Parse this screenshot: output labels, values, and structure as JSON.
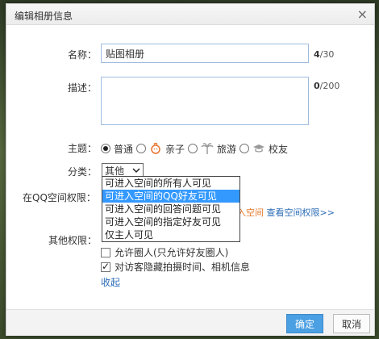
{
  "dialog": {
    "title": "编辑相册信息",
    "close_glyph": "×"
  },
  "form": {
    "name_label": "名称：",
    "name_value": "贴图相册",
    "name_count": "4",
    "name_max": "/30",
    "desc_label": "描述：",
    "desc_value": "",
    "desc_count": "0",
    "desc_max": "/200",
    "theme_label": "主题：",
    "themes": [
      {
        "label": "普通",
        "selected": true,
        "icon": "none"
      },
      {
        "label": "亲子",
        "selected": false,
        "icon": "baby-icon"
      },
      {
        "label": "旅游",
        "selected": false,
        "icon": "palm-tree-icon"
      },
      {
        "label": "校友",
        "selected": false,
        "icon": "graduation-cap-icon"
      }
    ],
    "category_label": "分类：",
    "category_value": "其他",
    "permission_label": "在QQ空间权限：",
    "permission_options": [
      "可进入空间的所有人可见",
      "可进入空间的QQ好友可见",
      "可进入空间的回答问题可见",
      "可进入空间的指定好友可见",
      "仅主人可见"
    ],
    "permission_selected_index": 1,
    "permission_hint_orange": "入空间",
    "permission_link": "查看空间权限>>",
    "other_label": "其他权限：",
    "other_options": [
      {
        "label": "允许圈人(只允许好友圈人)",
        "checked": false
      },
      {
        "label": "对访客隐藏拍摄时间、相机信息",
        "checked": true
      }
    ],
    "collapse_link": "收起"
  },
  "footer": {
    "ok_label": "确定",
    "cancel_label": "取消"
  },
  "colors": {
    "accent_blue": "#4b9fe3",
    "link_blue": "#2b6cb5",
    "hint_orange": "#e6792a",
    "selection": "#3399ff"
  }
}
